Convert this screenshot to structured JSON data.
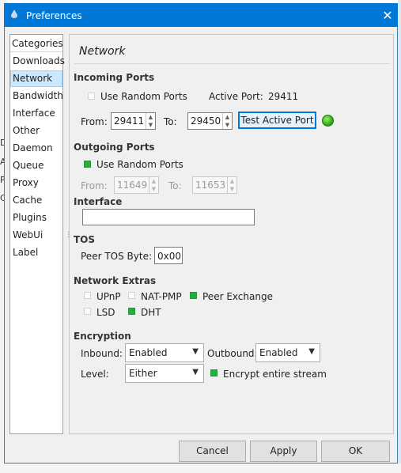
{
  "window": {
    "title": "Preferences"
  },
  "categories": {
    "header": "Categories",
    "items": [
      "Downloads",
      "Network",
      "Bandwidth",
      "Interface",
      "Other",
      "Daemon",
      "Queue",
      "Proxy",
      "Cache",
      "Plugins",
      "WebUi",
      "Label"
    ],
    "selected": "Network"
  },
  "page": {
    "title": "Network"
  },
  "incoming": {
    "heading": "Incoming Ports",
    "random_label": "Use Random Ports",
    "random_checked": false,
    "active_label": "Active Port:",
    "active_value": "29411",
    "from_label": "From:",
    "from_value": "29411",
    "to_label": "To:",
    "to_value": "29450",
    "test_button": "Test Active Port"
  },
  "outgoing": {
    "heading": "Outgoing Ports",
    "random_label": "Use Random Ports",
    "random_checked": true,
    "from_label": "From:",
    "from_value": "11649",
    "to_label": "To:",
    "to_value": "11653"
  },
  "interface": {
    "heading": "Interface",
    "value": ""
  },
  "tos": {
    "heading": "TOS",
    "label": "Peer TOS Byte:",
    "value": "0x00"
  },
  "extras": {
    "heading": "Network Extras",
    "upnp": "UPnP",
    "natpmp": "NAT-PMP",
    "pex": "Peer Exchange",
    "lsd": "LSD",
    "dht": "DHT",
    "checked": {
      "upnp": false,
      "natpmp": false,
      "pex": true,
      "lsd": false,
      "dht": true
    }
  },
  "encryption": {
    "heading": "Encryption",
    "inbound_label": "Inbound:",
    "inbound_value": "Enabled",
    "outbound_label": "Outbound:",
    "outbound_value": "Enabled",
    "level_label": "Level:",
    "level_value": "Either",
    "entire_stream_label": "Encrypt entire stream",
    "entire_stream_checked": true
  },
  "buttons": {
    "cancel": "Cancel",
    "apply": "Apply",
    "ok": "OK"
  },
  "colors": {
    "titlebar": "#0078d7",
    "selection": "#cce8ff",
    "checked": "#22b03d",
    "status_ok": "#3cc21c"
  }
}
